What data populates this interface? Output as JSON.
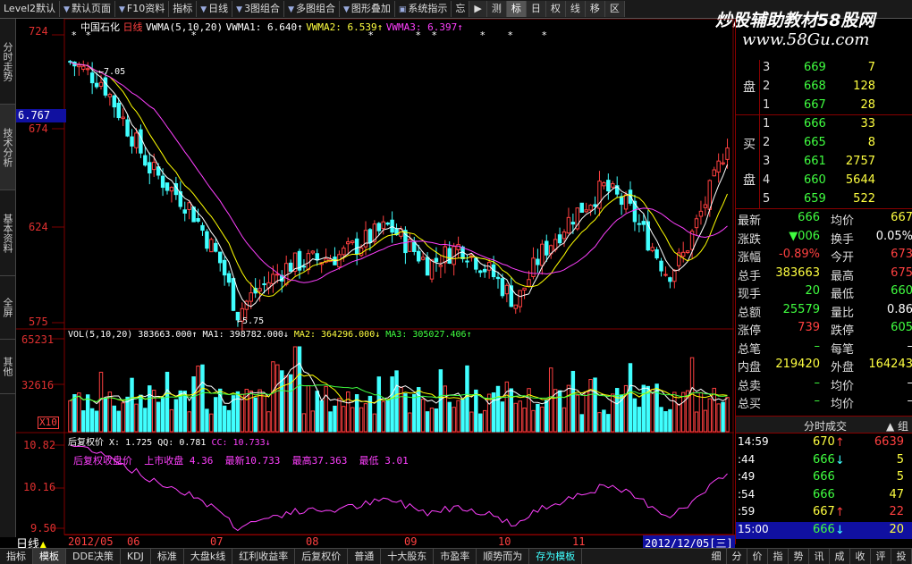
{
  "toolbar": {
    "items": [
      "Level2默认",
      "默认页面",
      "F10资料",
      "指标",
      "日线",
      "3图组合",
      "多图组合",
      "图形叠加",
      "系统指示",
      "忘"
    ],
    "nav": [
      "▶",
      "测",
      "标",
      "日",
      "权",
      "线",
      "移",
      "区"
    ]
  },
  "watermark": {
    "line1": "炒股辅助教材58股网",
    "line2": "www.58Gu.com"
  },
  "left_tabs": [
    "分时走势",
    "技术分析",
    "基本资料",
    "全屏",
    "其他"
  ],
  "price_chart": {
    "stock_name": "中国石化",
    "period": "日线",
    "indicator": "VWMA(5,10,20)",
    "vwma1": "VWMA1: 6.640↑",
    "vwma2": "VWMA2: 6.539↑",
    "vwma3": "VWMA3: 6.397↑",
    "axis": [
      "724",
      "674",
      "624",
      "575"
    ],
    "current_label": "6.767",
    "high_note": "7.05",
    "low_note": "5.75"
  },
  "vol_chart": {
    "indicator": "VOL(5,10,20)",
    "vol": "383663.000↑",
    "ma1": "MA1: 398782.000↓",
    "ma2": "MA2: 364296.000↓",
    "ma3": "MA3: 305027.406↑",
    "axis": [
      "65231",
      "32616"
    ],
    "unit": "X10"
  },
  "fq_chart": {
    "title": "后复权价",
    "x": "X: 1.725",
    "qq": "QQ: 0.781",
    "cc": "CC: 10.733↓",
    "desc": "后复权收盘价",
    "list_close": "上市收盘 4.36",
    "latest": "最新10.733",
    "highest": "最高37.363",
    "lowest": "最低 3.01",
    "axis": [
      "10.82",
      "10.16",
      "9.50"
    ]
  },
  "date_bar": {
    "period": "日线",
    "months": [
      "2012/05",
      "06",
      "07",
      "08",
      "09",
      "10",
      "11"
    ],
    "current_date": "2012/12/05[三]"
  },
  "bottom_tabs": [
    "指标",
    "模板",
    "DDE决策",
    "KDJ",
    "标准",
    "大盘k线",
    "红利收益率",
    "后复权价",
    "普通",
    "十大股东",
    "市盈率",
    "顺势而为",
    "存为模板"
  ],
  "right_tabs": [
    "细",
    "分",
    "价",
    "指",
    "势",
    "讯",
    "成",
    "收",
    "评",
    "投"
  ],
  "order_book": {
    "sell_label": [
      "卖",
      "盘"
    ],
    "buy_label": [
      "买",
      "盘"
    ],
    "sell": [
      {
        "lv": "3",
        "price": "669",
        "vol": "7"
      },
      {
        "lv": "2",
        "price": "668",
        "vol": "128"
      },
      {
        "lv": "1",
        "price": "667",
        "vol": "28"
      }
    ],
    "buy": [
      {
        "lv": "1",
        "price": "666",
        "vol": "33"
      },
      {
        "lv": "2",
        "price": "665",
        "vol": "8"
      },
      {
        "lv": "3",
        "price": "661",
        "vol": "2757"
      },
      {
        "lv": "4",
        "price": "660",
        "vol": "5644"
      },
      {
        "lv": "5",
        "price": "659",
        "vol": "522"
      }
    ]
  },
  "quote": [
    {
      "l": "最新",
      "v": "666",
      "l2": "均价",
      "v2": "667"
    },
    {
      "l": "涨跌",
      "v": "▼006",
      "l2": "换手",
      "v2": "0.05%"
    },
    {
      "l": "涨幅",
      "v": "-0.89%",
      "l2": "今开",
      "v2": "673"
    },
    {
      "l": "总手",
      "v": "383663",
      "l2": "最高",
      "v2": "675"
    },
    {
      "l": "现手",
      "v": "20",
      "l2": "最低",
      "v2": "660"
    },
    {
      "l": "总额",
      "v": "25579",
      "l2": "量比",
      "v2": "0.86"
    },
    {
      "l": "涨停",
      "v": "739",
      "l2": "跌停",
      "v2": "605"
    },
    {
      "l": "总笔",
      "v": "–",
      "l2": "每笔",
      "v2": "–"
    },
    {
      "l": "内盘",
      "v": "219420",
      "l2": "外盘",
      "v2": "164243"
    },
    {
      "l": "总卖",
      "v": "–",
      "l2": "均价",
      "v2": "–"
    },
    {
      "l": "总买",
      "v": "–",
      "l2": "均价",
      "v2": "–"
    }
  ],
  "ticks": {
    "title": "分时成交",
    "group": "组",
    "rows": [
      {
        "t": "14:59",
        "p": "670↑",
        "v": "6639"
      },
      {
        "t": ":44",
        "p": "666↓",
        "v": "5"
      },
      {
        "t": ":49",
        "p": "666",
        "v": "5"
      },
      {
        "t": ":54",
        "p": "666",
        "v": "47"
      },
      {
        "t": ":59",
        "p": "667↑",
        "v": "22"
      },
      {
        "t": "15:00",
        "p": "666↓",
        "v": "20"
      }
    ]
  },
  "colors": {
    "up": "#ff4040",
    "down": "#40ffff",
    "ma1": "#ffffff",
    "ma2": "#ffff00",
    "ma3": "#ff40ff",
    "axis": "#800000"
  }
}
